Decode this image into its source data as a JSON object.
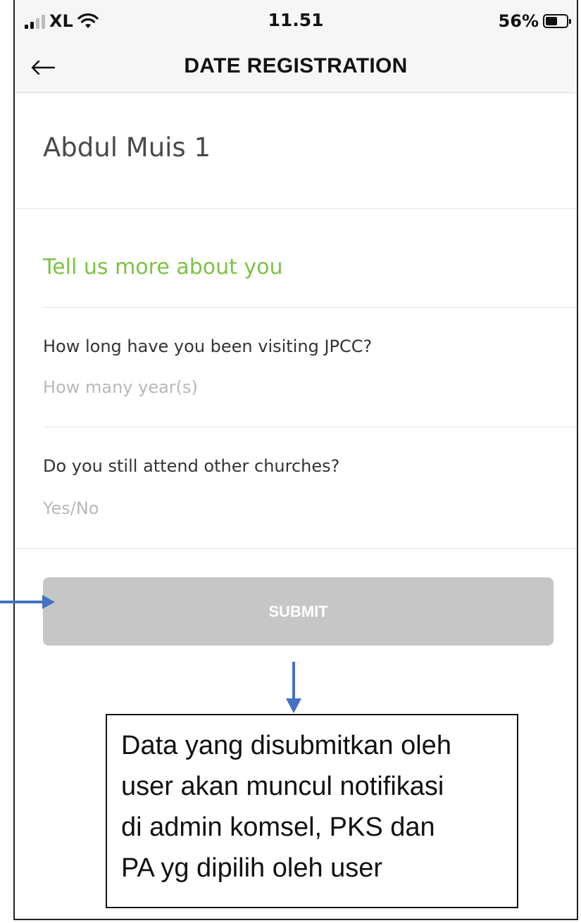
{
  "status_bar": {
    "carrier": "XL",
    "time": "11.51",
    "battery_percent": "56%",
    "battery_level": 0.56,
    "icons": [
      "signal-icon",
      "wifi-icon",
      "battery-icon"
    ]
  },
  "header": {
    "title": "DATE REGISTRATION",
    "back_icon": "back-arrow-icon"
  },
  "profile": {
    "name": "Abdul Muis 1"
  },
  "form": {
    "section_title": "Tell us more about you",
    "fields": [
      {
        "question": "How long have you been visiting JPCC?",
        "placeholder": "How many year(s)",
        "value": ""
      },
      {
        "question": "Do you still attend other churches?",
        "placeholder": "Yes/No",
        "value": ""
      }
    ],
    "submit_label": "SUBMIT"
  },
  "annotation": {
    "lines": [
      "Data yang disubmitkan oleh",
      "user akan muncul notifikasi",
      "di admin komsel, PKS dan",
      "PA yg dipilih oleh user"
    ]
  },
  "colors": {
    "accent_green": "#7cc242",
    "button_disabled": "#c6c6c6",
    "annotation_arrow": "#4472c4"
  }
}
